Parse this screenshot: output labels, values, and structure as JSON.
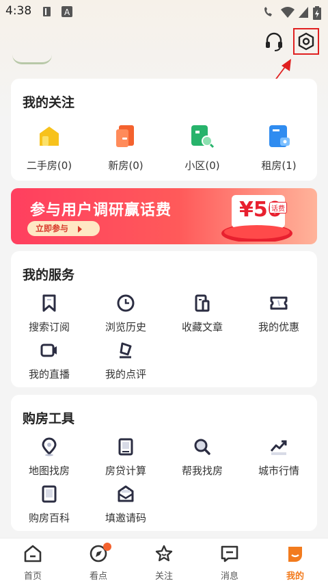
{
  "status_bar": {
    "time": "4:38"
  },
  "header": {
    "support_icon": "headset-icon",
    "settings_icon": "settings-hexagon-icon"
  },
  "follow": {
    "title": "我的关注",
    "items": [
      {
        "label": "二手房(0)",
        "icon": "secondhand-house-icon",
        "color": "#f7c21c"
      },
      {
        "label": "新房(0)",
        "icon": "new-house-icon",
        "color": "#f4622e"
      },
      {
        "label": "小区(0)",
        "icon": "community-icon",
        "color": "#27b36b"
      },
      {
        "label": "租房(1)",
        "icon": "rent-icon",
        "color": "#2f8cf0"
      }
    ]
  },
  "banner": {
    "title": "参与用户调研赢话费",
    "button": "立即参与",
    "amount": "¥50",
    "tag": "话费"
  },
  "services": {
    "title": "我的服务",
    "items": [
      {
        "label": "搜索订阅",
        "icon": "bookmark-icon"
      },
      {
        "label": "浏览历史",
        "icon": "clock-icon"
      },
      {
        "label": "收藏文章",
        "icon": "article-icon"
      },
      {
        "label": "我的优惠",
        "icon": "ticket-icon"
      },
      {
        "label": "我的直播",
        "icon": "video-icon"
      },
      {
        "label": "我的点评",
        "icon": "pen-icon"
      }
    ]
  },
  "tools": {
    "title": "购房工具",
    "items": [
      {
        "label": "地图找房",
        "icon": "map-pin-icon"
      },
      {
        "label": "房贷计算",
        "icon": "calculator-icon"
      },
      {
        "label": "帮我找房",
        "icon": "search-icon"
      },
      {
        "label": "城市行情",
        "icon": "trend-icon"
      },
      {
        "label": "购房百科",
        "icon": "book-icon"
      },
      {
        "label": "填邀请码",
        "icon": "envelope-icon"
      }
    ]
  },
  "tabbar": {
    "items": [
      {
        "label": "首页",
        "icon": "home-icon"
      },
      {
        "label": "看点",
        "icon": "discover-icon"
      },
      {
        "label": "关注",
        "icon": "star-icon"
      },
      {
        "label": "消息",
        "icon": "message-icon"
      },
      {
        "label": "我的",
        "icon": "profile-icon"
      }
    ],
    "active": "我的",
    "accent": "#f27b1e"
  },
  "annotation_color": "#e02020"
}
